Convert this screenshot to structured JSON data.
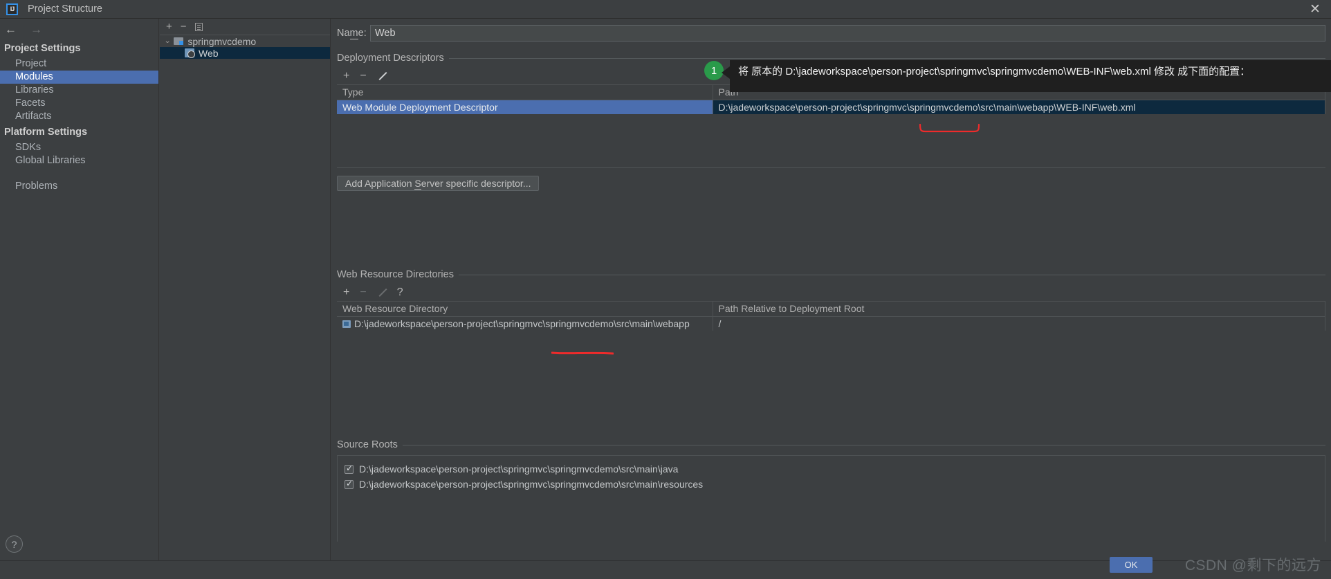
{
  "window": {
    "title": "Project Structure",
    "logo_text": "IJ",
    "close_icon": "✕"
  },
  "sidebar": {
    "back_arrow": "←",
    "forward_arrow": "→",
    "groups": [
      {
        "header": "Project Settings",
        "items": [
          {
            "label": "Project",
            "selected": false
          },
          {
            "label": "Modules",
            "selected": true
          },
          {
            "label": "Libraries",
            "selected": false
          },
          {
            "label": "Facets",
            "selected": false
          },
          {
            "label": "Artifacts",
            "selected": false
          }
        ]
      },
      {
        "header": "Platform Settings",
        "items": [
          {
            "label": "SDKs",
            "selected": false
          },
          {
            "label": "Global Libraries",
            "selected": false
          }
        ]
      }
    ],
    "problems_label": "Problems"
  },
  "tree": {
    "toolbar": {
      "add": "+",
      "remove": "−",
      "copy_icon": "copy-icon"
    },
    "root": {
      "label": "springmvcdemo",
      "chevron": "⌄"
    },
    "child": {
      "label": "Web"
    }
  },
  "main": {
    "name": {
      "label_prefix": "Na",
      "label_accel": "m",
      "label_suffix": "e:",
      "value": "Web"
    },
    "deployment_descriptors": {
      "section_title": "Deployment Descriptors",
      "toolbar": {
        "add": "+",
        "remove": "−",
        "edit": "pencil-icon"
      },
      "columns": [
        "Type",
        "Path"
      ],
      "rows": [
        {
          "type": "Web Module Deployment Descriptor",
          "path": "D:\\jadeworkspace\\person-project\\springmvc\\springmvcdemo\\src\\main\\webapp\\WEB-INF\\web.xml",
          "selected": true
        }
      ],
      "add_button": {
        "prefix": "Add Application ",
        "accel": "S",
        "suffix": "erver specific descriptor..."
      }
    },
    "web_resource_directories": {
      "section_title": "Web Resource Directories",
      "toolbar": {
        "add": "+",
        "remove": "−",
        "edit": "pencil-icon",
        "help": "?"
      },
      "columns": [
        "Web Resource Directory",
        "Path Relative to Deployment Root"
      ],
      "rows": [
        {
          "directory": "D:\\jadeworkspace\\person-project\\springmvc\\springmvcdemo\\src\\main\\webapp",
          "relative_path": "/"
        }
      ]
    },
    "source_roots": {
      "section_title": "Source Roots",
      "items": [
        {
          "path": "D:\\jadeworkspace\\person-project\\springmvc\\springmvcdemo\\src\\main\\java",
          "checked": true
        },
        {
          "path": "D:\\jadeworkspace\\person-project\\springmvc\\springmvcdemo\\src\\main\\resources",
          "checked": true
        }
      ]
    }
  },
  "callout": {
    "badge": "1",
    "text": "将 原本的 D:\\jadeworkspace\\person-project\\springmvc\\springmvcdemo\\WEB-INF\\web.xml 修改 成下面的配置："
  },
  "footer": {
    "help": "?",
    "ok_label": "OK",
    "watermark": "CSDN @剩下的远方"
  },
  "colors": {
    "background": "#3c3f41",
    "selection_blue": "#4b6eaf",
    "selection_dark": "#0d293e",
    "accent_green": "#2a9a4a",
    "annotation_red": "#ee2b2b",
    "tooltip_bg": "#1f1f1f"
  }
}
